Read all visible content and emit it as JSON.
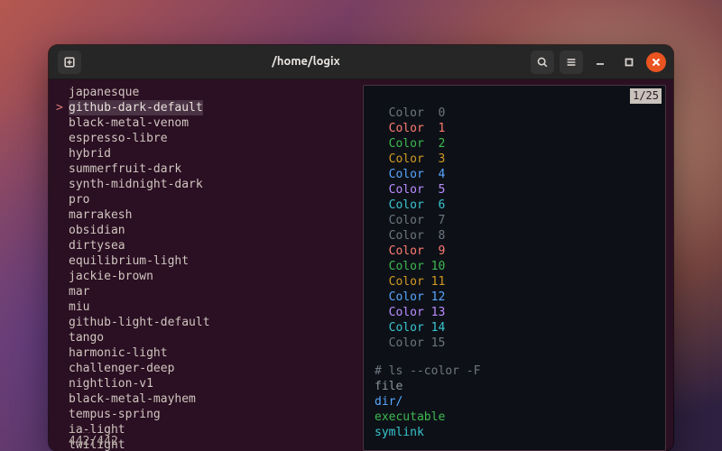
{
  "window": {
    "title": "/home/logix",
    "newtab_icon": "new-tab-icon",
    "search_icon": "search-icon",
    "menu_icon": "hamburger-icon",
    "min_icon": "minimize-icon",
    "max_icon": "maximize-icon",
    "close_icon": "close-icon"
  },
  "themes": {
    "selected_index": 1,
    "counter": "442/442",
    "items": [
      "japanesque",
      "github-dark-default",
      "black-metal-venom",
      "espresso-libre",
      "hybrid",
      "summerfruit-dark",
      "synth-midnight-dark",
      "pro",
      "marrakesh",
      "obsidian",
      "dirtysea",
      "equilibrium-light",
      "jackie-brown",
      "mar",
      "miu",
      "github-light-default",
      "tango",
      "harmonic-light",
      "challenger-deep",
      "nightlion-v1",
      "black-metal-mayhem",
      "tempus-spring",
      "ia-light",
      "twilight"
    ]
  },
  "preview": {
    "badge": "1/25",
    "colors": [
      {
        "label": "Color",
        "n": "0",
        "hex": "#6e7681"
      },
      {
        "label": "Color",
        "n": "1",
        "hex": "#ff7b72"
      },
      {
        "label": "Color",
        "n": "2",
        "hex": "#3fb950"
      },
      {
        "label": "Color",
        "n": "3",
        "hex": "#d29922"
      },
      {
        "label": "Color",
        "n": "4",
        "hex": "#58a6ff"
      },
      {
        "label": "Color",
        "n": "5",
        "hex": "#bc8cff"
      },
      {
        "label": "Color",
        "n": "6",
        "hex": "#39c5cf"
      },
      {
        "label": "Color",
        "n": "7",
        "hex": "#6e7681"
      },
      {
        "label": "Color",
        "n": "8",
        "hex": "#6e7681"
      },
      {
        "label": "Color",
        "n": "9",
        "hex": "#ff7b72"
      },
      {
        "label": "Color",
        "n": "10",
        "hex": "#3fb950"
      },
      {
        "label": "Color",
        "n": "11",
        "hex": "#d29922"
      },
      {
        "label": "Color",
        "n": "12",
        "hex": "#58a6ff"
      },
      {
        "label": "Color",
        "n": "13",
        "hex": "#bc8cff"
      },
      {
        "label": "Color",
        "n": "14",
        "hex": "#39c5cf"
      },
      {
        "label": "Color",
        "n": "15",
        "hex": "#6e7681"
      }
    ],
    "ls_header": "# ls --color -F",
    "ls_items": [
      {
        "text": "file",
        "hex": "#8b949e"
      },
      {
        "text": "dir/",
        "hex": "#58a6ff"
      },
      {
        "text": "executable",
        "hex": "#3fb950"
      },
      {
        "text": "symlink",
        "hex": "#39c5cf"
      }
    ]
  }
}
